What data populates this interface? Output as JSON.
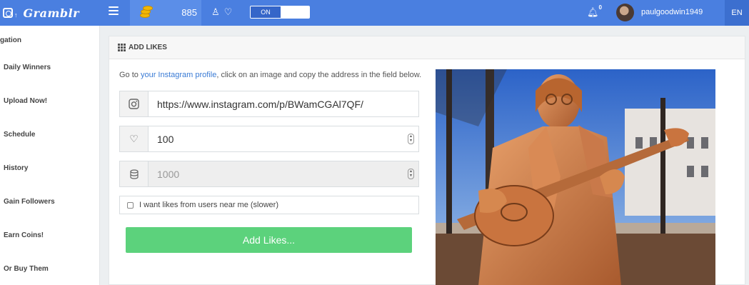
{
  "app": {
    "brand": "Gramblr",
    "upload_arrow": "↑"
  },
  "topbar": {
    "coins": "885",
    "toggle_label": "ON",
    "notifications_count": "0",
    "username": "paulgoodwin1949",
    "language": "EN",
    "accent_color": "#4a7fe0",
    "icons": [
      "menu-icon",
      "coins-icon",
      "like-icon",
      "heart-icon",
      "bell-icon",
      "avatar"
    ]
  },
  "sidebar": {
    "heading": "gation",
    "items": [
      "Daily Winners",
      "Upload Now!",
      "Schedule",
      "History",
      "Gain Followers",
      "Earn Coins!",
      "Or Buy Them"
    ]
  },
  "card": {
    "title": "ADD LIKES",
    "intro_prefix": "Go to ",
    "intro_link": "your Instagram profile",
    "intro_suffix": ", click on an image and copy the address in the field below.",
    "url_value": "https://www.instagram.com/p/BWamCGAl7QF/",
    "likes_value": "100",
    "coins_value": "1000",
    "near_me_label": "I want likes from users near me (slower)",
    "submit_label": "Add Likes...",
    "submit_color": "#5cd27c"
  }
}
